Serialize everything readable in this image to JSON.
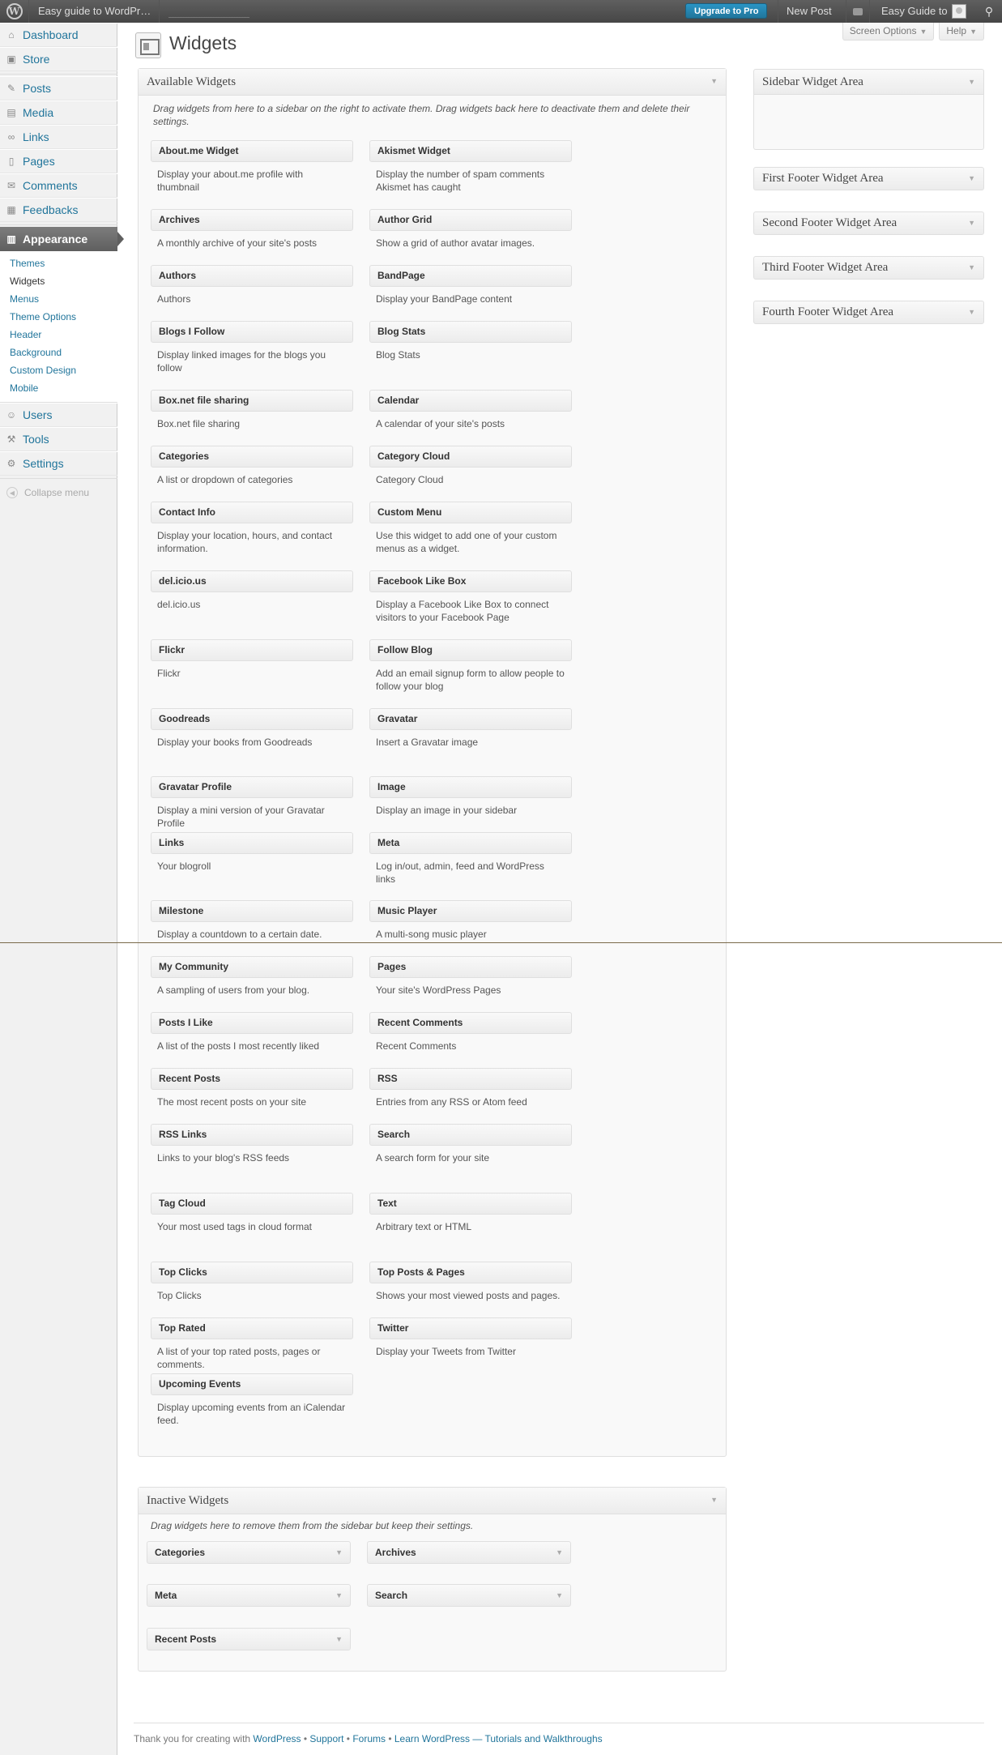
{
  "adminbar": {
    "site_name": "Easy guide to WordPr…",
    "upgrade_label": "Upgrade to Pro",
    "new_post_label": "New Post",
    "account_label": "Easy Guide to"
  },
  "menu": {
    "items_top": [
      {
        "label": "Dashboard",
        "icon": "dashboard-icon"
      },
      {
        "label": "Store",
        "icon": "store-icon"
      }
    ],
    "items_mid": [
      {
        "label": "Posts",
        "icon": "pin-icon"
      },
      {
        "label": "Media",
        "icon": "media-icon"
      },
      {
        "label": "Links",
        "icon": "link-icon"
      },
      {
        "label": "Pages",
        "icon": "pages-icon"
      },
      {
        "label": "Comments",
        "icon": "comment-icon"
      },
      {
        "label": "Feedbacks",
        "icon": "feedback-icon"
      }
    ],
    "current": {
      "label": "Appearance",
      "icon": "appearance-icon"
    },
    "submenu": [
      "Themes",
      "Widgets",
      "Menus",
      "Theme Options",
      "Header",
      "Background",
      "Custom Design",
      "Mobile"
    ],
    "items_bottom": [
      {
        "label": "Users",
        "icon": "users-icon"
      },
      {
        "label": "Tools",
        "icon": "tools-icon"
      },
      {
        "label": "Settings",
        "icon": "settings-icon"
      }
    ],
    "collapse_label": "Collapse menu"
  },
  "screen_options_label": "Screen Options",
  "help_label": "Help",
  "page_title": "Widgets",
  "available": {
    "title": "Available Widgets",
    "description": "Drag widgets from here to a sidebar on the right to activate them. Drag widgets back here to deactivate them and delete their settings.",
    "widgets": [
      {
        "title": "About.me Widget",
        "desc": "Display your about.me profile with thumbnail"
      },
      {
        "title": "Akismet Widget",
        "desc": "Display the number of spam comments Akismet has caught"
      },
      {
        "title": "Archives",
        "desc": "A monthly archive of your site's posts"
      },
      {
        "title": "Author Grid",
        "desc": "Show a grid of author avatar images."
      },
      {
        "title": "Authors",
        "desc": "Authors"
      },
      {
        "title": "BandPage",
        "desc": "Display your BandPage content"
      },
      {
        "title": "Blogs I Follow",
        "desc": "Display linked images for the blogs you follow"
      },
      {
        "title": "Blog Stats",
        "desc": "Blog Stats"
      },
      {
        "title": "Box.net file sharing",
        "desc": "Box.net file sharing"
      },
      {
        "title": "Calendar",
        "desc": "A calendar of your site's posts"
      },
      {
        "title": "Categories",
        "desc": "A list or dropdown of categories"
      },
      {
        "title": "Category Cloud",
        "desc": "Category Cloud"
      },
      {
        "title": "Contact Info",
        "desc": "Display your location, hours, and contact information."
      },
      {
        "title": "Custom Menu",
        "desc": "Use this widget to add one of your custom menus as a widget."
      },
      {
        "title": "del.icio.us",
        "desc": "del.icio.us"
      },
      {
        "title": "Facebook Like Box",
        "desc": "Display a Facebook Like Box to connect visitors to your Facebook Page"
      },
      {
        "title": "Flickr",
        "desc": "Flickr"
      },
      {
        "title": "Follow Blog",
        "desc": "Add an email signup form to allow people to follow your blog"
      },
      {
        "title": "Goodreads",
        "desc": "Display your books from Goodreads"
      },
      {
        "title": "Gravatar",
        "desc": "Insert a Gravatar image"
      },
      {
        "title": "Gravatar Profile",
        "desc": "Display a mini version of your Gravatar Profile"
      },
      {
        "title": "Image",
        "desc": "Display an image in your sidebar"
      },
      {
        "title": "Links",
        "desc": "Your blogroll"
      },
      {
        "title": "Meta",
        "desc": "Log in/out, admin, feed and WordPress links"
      },
      {
        "title": "Milestone",
        "desc": "Display a countdown to a certain date."
      },
      {
        "title": "Music Player",
        "desc": "A multi-song music player"
      },
      {
        "title": "My Community",
        "desc": "A sampling of users from your blog."
      },
      {
        "title": "Pages",
        "desc": "Your site's WordPress Pages"
      },
      {
        "title": "Posts I Like",
        "desc": "A list of the posts I most recently liked"
      },
      {
        "title": "Recent Comments",
        "desc": "Recent Comments"
      },
      {
        "title": "Recent Posts",
        "desc": "The most recent posts on your site"
      },
      {
        "title": "RSS",
        "desc": "Entries from any RSS or Atom feed"
      },
      {
        "title": "RSS Links",
        "desc": "Links to your blog's RSS feeds"
      },
      {
        "title": "Search",
        "desc": "A search form for your site"
      },
      {
        "title": "Tag Cloud",
        "desc": "Your most used tags in cloud format"
      },
      {
        "title": "Text",
        "desc": "Arbitrary text or HTML"
      },
      {
        "title": "Top Clicks",
        "desc": "Top Clicks"
      },
      {
        "title": "Top Posts & Pages",
        "desc": "Shows your most viewed posts and pages."
      },
      {
        "title": "Top Rated",
        "desc": "A list of your top rated posts, pages or comments."
      },
      {
        "title": "Twitter",
        "desc": "Display your Tweets from Twitter"
      },
      {
        "title": "Upcoming Events",
        "desc": "Display upcoming events from an iCalendar feed."
      }
    ]
  },
  "inactive": {
    "title": "Inactive Widgets",
    "description": "Drag widgets here to remove them from the sidebar but keep their settings.",
    "widgets": [
      "Categories",
      "Archives",
      "Meta",
      "Search",
      "Recent Posts"
    ]
  },
  "sidebars": [
    "Sidebar Widget Area",
    "First Footer Widget Area",
    "Second Footer Widget Area",
    "Third Footer Widget Area",
    "Fourth Footer Widget Area"
  ],
  "footer": {
    "prefix": "Thank you for creating with ",
    "links": [
      "WordPress",
      "Support",
      "Forums",
      "Learn WordPress — Tutorials and Walkthroughs"
    ],
    "separator": " • "
  }
}
